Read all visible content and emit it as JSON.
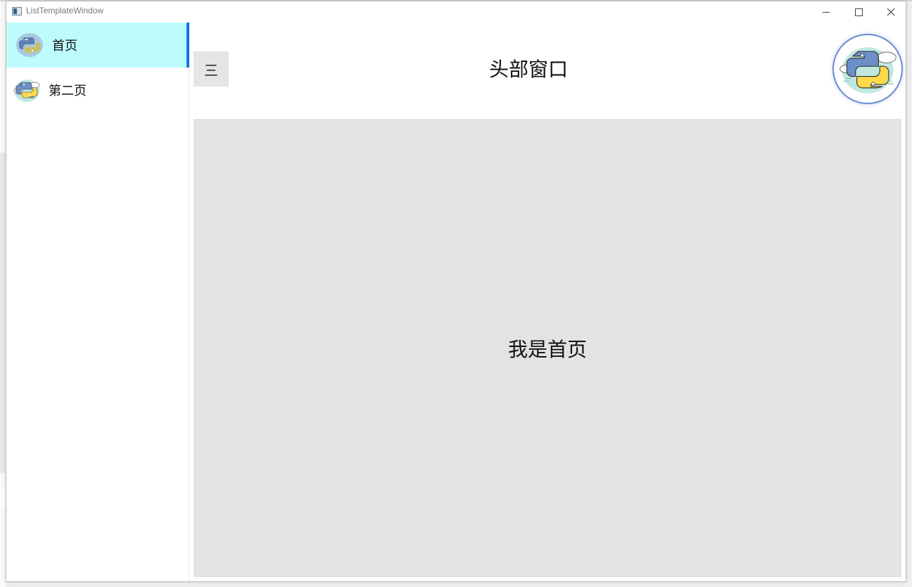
{
  "window": {
    "title": "ListTemplateWindow",
    "controls": {
      "minimize": "minimize",
      "maximize": "maximize",
      "close": "close"
    }
  },
  "sidebar": {
    "items": [
      {
        "label": "首页",
        "icon": "python-icon",
        "active": true
      },
      {
        "label": "第二页",
        "icon": "python-icon",
        "active": false
      }
    ]
  },
  "header": {
    "menu_label": "三",
    "title": "头部窗口",
    "avatar_icon": "python-logo-icon"
  },
  "content": {
    "text": "我是首页"
  },
  "colors": {
    "active_item_bg": "#bdfcfc",
    "active_indicator": "#1a73e8",
    "content_bg": "#e3e3e3",
    "menu_button_bg": "#e5e5e5"
  }
}
